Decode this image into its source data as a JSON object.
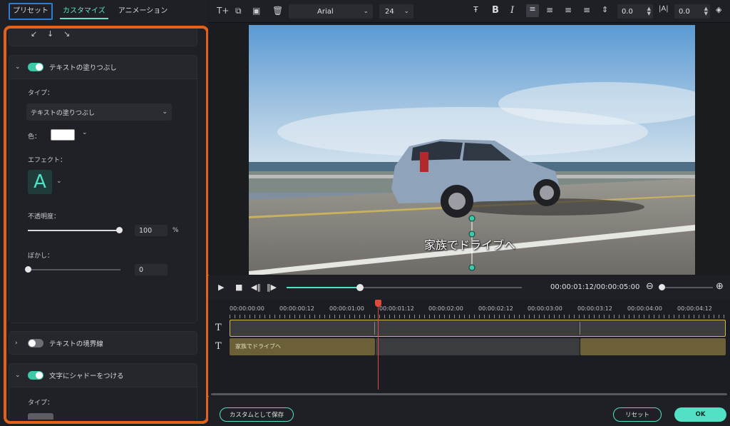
{
  "tabs": {
    "preset": "プリセット",
    "customize": "カスタマイズ",
    "animation": "アニメーション"
  },
  "arrows": {
    "a1": "↙",
    "a2": "↓",
    "a3": "↘"
  },
  "fill_section": {
    "title": "テキストの塗りつぶし",
    "type_label": "タイプ：",
    "type_value": "テキストの塗りつぶし",
    "color_label": "色：",
    "color": "#ffffff",
    "effect_label": "エフェクト：",
    "effect_glyph": "A",
    "opacity_label": "不透明度：",
    "opacity_value": "100",
    "opacity_unit": "%",
    "opacity_level": 1.0,
    "blur_label": "ぼかし：",
    "blur_value": "0",
    "blur_level": 0.0
  },
  "border_section": {
    "title": "テキストの境界線"
  },
  "shadow_section": {
    "title": "文字にシャドーをつける",
    "type_label": "タイプ："
  },
  "toolbar": {
    "font": "Arial",
    "font_size": "24",
    "line_spacing": "0.0",
    "letter_spacing": "0.0",
    "bold": "B",
    "italic": "I"
  },
  "video": {
    "caption": "家族でドライブへ"
  },
  "playback": {
    "timecode": "00:00:01:12/00:00:05:00",
    "progress": 0.31
  },
  "timeline": {
    "ruler": [
      "00:00:00:00",
      "00:00:00:12",
      "00:00:01:00",
      "00:00:01:12",
      "00:00:02:00",
      "00:00:02:12",
      "00:00:03:00",
      "00:00:03:12",
      "00:00:04:00",
      "00:00:04:12"
    ],
    "clip_label": "家族でドライブへ"
  },
  "buttons": {
    "save_custom": "カスタムとして保存",
    "reset": "リセット",
    "ok": "OK"
  },
  "colors": {
    "accent": "#53e1c5",
    "highlight": "#e2611c",
    "playhead": "#e04a3a"
  }
}
